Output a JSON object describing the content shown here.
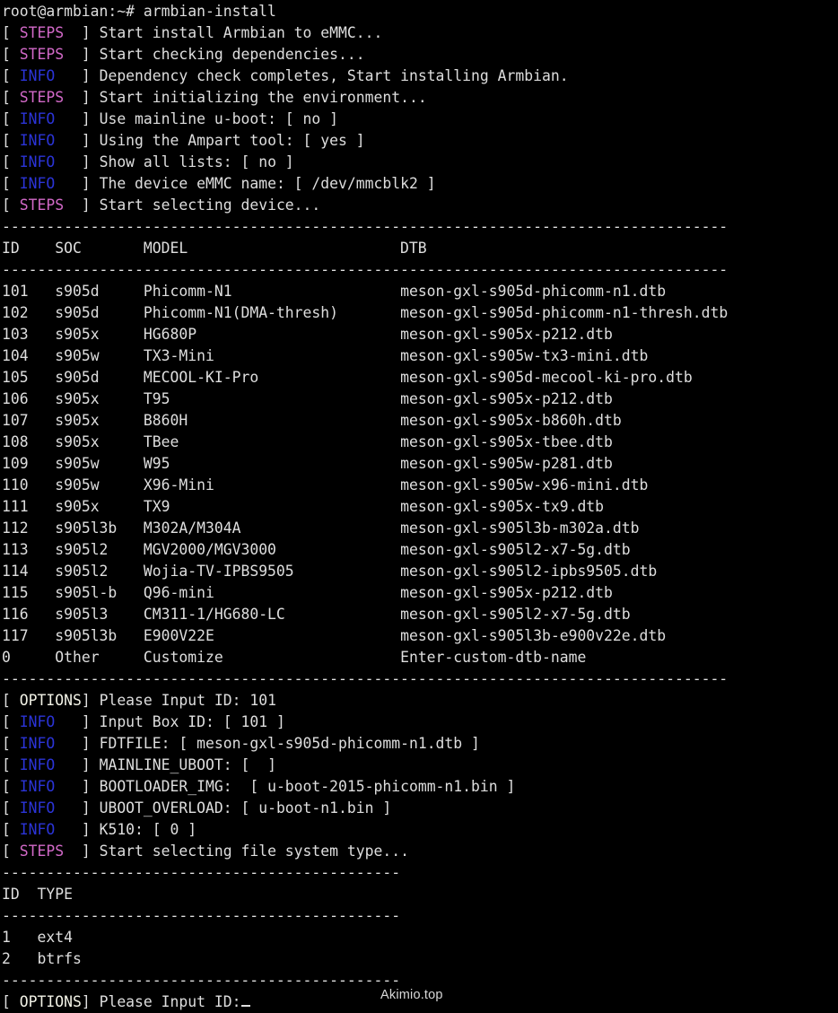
{
  "terminal": {
    "prompt_line": "root@armbian:~# armbian-install",
    "colors": {
      "background": "#000000",
      "foreground": "#dedede",
      "steps_tag": "#d269c8",
      "info_tag": "#2b34d8",
      "options_tag": "#f2f2e6",
      "watermark": "#2f8fd0"
    },
    "separator_long": "------------------------------------------------------------------------------------",
    "separator_short": "--------------------------------------------------",
    "log_lines_top": [
      {
        "tag": "STEPS",
        "tag_class": "steps",
        "text": "Start install Armbian to eMMC..."
      },
      {
        "tag": "STEPS",
        "tag_class": "steps",
        "text": "Start checking dependencies..."
      },
      {
        "tag": "INFO",
        "tag_class": "info",
        "text": "Dependency check completes, Start installing Armbian."
      },
      {
        "tag": "STEPS",
        "tag_class": "steps",
        "text": "Start initializing the environment..."
      },
      {
        "tag": "INFO",
        "tag_class": "info",
        "text": "Use mainline u-boot: [ no ]"
      },
      {
        "tag": "INFO",
        "tag_class": "info",
        "text": "Using the Ampart tool: [ yes ]"
      },
      {
        "tag": "INFO",
        "tag_class": "info",
        "text": "Show all lists: [ no ]"
      },
      {
        "tag": "INFO",
        "tag_class": "info",
        "text": "The device eMMC name: [ /dev/mmcblk2 ]"
      },
      {
        "tag": "STEPS",
        "tag_class": "steps",
        "text": "Start selecting device..."
      }
    ],
    "device_table": {
      "headers": {
        "id": "ID",
        "soc": "SOC",
        "model": "MODEL",
        "dtb": "DTB"
      },
      "rows": [
        {
          "id": "101",
          "soc": "s905d",
          "model": "Phicomm-N1",
          "dtb": "meson-gxl-s905d-phicomm-n1.dtb"
        },
        {
          "id": "102",
          "soc": "s905d",
          "model": "Phicomm-N1(DMA-thresh)",
          "dtb": "meson-gxl-s905d-phicomm-n1-thresh.dtb"
        },
        {
          "id": "103",
          "soc": "s905x",
          "model": "HG680P",
          "dtb": "meson-gxl-s905x-p212.dtb"
        },
        {
          "id": "104",
          "soc": "s905w",
          "model": "TX3-Mini",
          "dtb": "meson-gxl-s905w-tx3-mini.dtb"
        },
        {
          "id": "105",
          "soc": "s905d",
          "model": "MECOOL-KI-Pro",
          "dtb": "meson-gxl-s905d-mecool-ki-pro.dtb"
        },
        {
          "id": "106",
          "soc": "s905x",
          "model": "T95",
          "dtb": "meson-gxl-s905x-p212.dtb"
        },
        {
          "id": "107",
          "soc": "s905x",
          "model": "B860H",
          "dtb": "meson-gxl-s905x-b860h.dtb"
        },
        {
          "id": "108",
          "soc": "s905x",
          "model": "TBee",
          "dtb": "meson-gxl-s905x-tbee.dtb"
        },
        {
          "id": "109",
          "soc": "s905w",
          "model": "W95",
          "dtb": "meson-gxl-s905w-p281.dtb"
        },
        {
          "id": "110",
          "soc": "s905w",
          "model": "X96-Mini",
          "dtb": "meson-gxl-s905w-x96-mini.dtb"
        },
        {
          "id": "111",
          "soc": "s905x",
          "model": "TX9",
          "dtb": "meson-gxl-s905x-tx9.dtb"
        },
        {
          "id": "112",
          "soc": "s905l3b",
          "model": "M302A/M304A",
          "dtb": "meson-gxl-s905l3b-m302a.dtb"
        },
        {
          "id": "113",
          "soc": "s905l2",
          "model": "MGV2000/MGV3000",
          "dtb": "meson-gxl-s905l2-x7-5g.dtb"
        },
        {
          "id": "114",
          "soc": "s905l2",
          "model": "Wojia-TV-IPBS9505",
          "dtb": "meson-gxl-s905l2-ipbs9505.dtb"
        },
        {
          "id": "115",
          "soc": "s905l-b",
          "model": "Q96-mini",
          "dtb": "meson-gxl-s905x-p212.dtb"
        },
        {
          "id": "116",
          "soc": "s905l3",
          "model": "CM311-1/HG680-LC",
          "dtb": "meson-gxl-s905l2-x7-5g.dtb"
        },
        {
          "id": "117",
          "soc": "s905l3b",
          "model": "E900V22E",
          "dtb": "meson-gxl-s905l3b-e900v22e.dtb"
        },
        {
          "id": "0",
          "soc": "Other",
          "model": "Customize",
          "dtb": "Enter-custom-dtb-name"
        }
      ]
    },
    "log_lines_mid": [
      {
        "tag": "OPTIONS",
        "tag_class": "options",
        "text": "Please Input ID: 101"
      },
      {
        "tag": "INFO",
        "tag_class": "info",
        "text": "Input Box ID: [ 101 ]"
      },
      {
        "tag": "INFO",
        "tag_class": "info",
        "text": "FDTFILE: [ meson-gxl-s905d-phicomm-n1.dtb ]"
      },
      {
        "tag": "INFO",
        "tag_class": "info",
        "text": "MAINLINE_UBOOT: [  ]"
      },
      {
        "tag": "INFO",
        "tag_class": "info",
        "text": "BOOTLOADER_IMG:  [ u-boot-2015-phicomm-n1.bin ]"
      },
      {
        "tag": "INFO",
        "tag_class": "info",
        "text": "UBOOT_OVERLOAD: [ u-boot-n1.bin ]"
      },
      {
        "tag": "INFO",
        "tag_class": "info",
        "text": "K510: [ 0 ]"
      },
      {
        "tag": "STEPS",
        "tag_class": "steps",
        "text": "Start selecting file system type..."
      }
    ],
    "fs_table": {
      "headers": {
        "id": "ID",
        "type": "TYPE"
      },
      "rows": [
        {
          "id": "1",
          "type": "ext4"
        },
        {
          "id": "2",
          "type": "btrfs"
        }
      ]
    },
    "final_prompt": {
      "tag": "OPTIONS",
      "tag_class": "options",
      "text": "Please Input ID:"
    },
    "watermark": "Akimio.top"
  }
}
